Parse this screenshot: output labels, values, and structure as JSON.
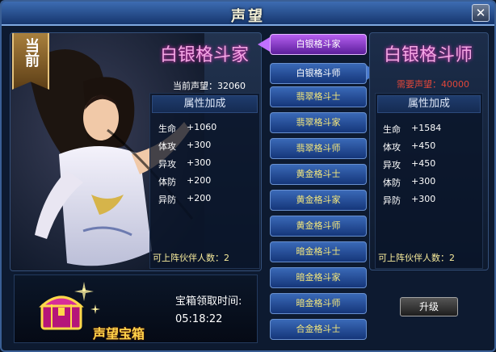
{
  "window": {
    "title": "声望",
    "close_label": "✕"
  },
  "current": {
    "badge": "当前",
    "rank_name": "白银格斗家",
    "reputation_label": "当前声望：32060",
    "stats_header": "属性加成",
    "stats": [
      {
        "name": "生命",
        "value": "+1060"
      },
      {
        "name": "体攻",
        "value": "+300"
      },
      {
        "name": "异攻",
        "value": "+300"
      },
      {
        "name": "体防",
        "value": "+200"
      },
      {
        "name": "异防",
        "value": "+200"
      }
    ],
    "partners_label": "可上阵伙伴人数：2"
  },
  "chest": {
    "name": "声望宝箱",
    "time_label": "宝箱领取时间:",
    "time_value": "05:18:22"
  },
  "ranks": [
    {
      "label": "白银格斗家",
      "state": "active"
    },
    {
      "label": "白银格斗师",
      "state": "selected"
    },
    {
      "label": "翡翠格斗士",
      "state": "normal"
    },
    {
      "label": "翡翠格斗家",
      "state": "normal"
    },
    {
      "label": "翡翠格斗师",
      "state": "normal"
    },
    {
      "label": "黄金格斗士",
      "state": "normal"
    },
    {
      "label": "黄金格斗家",
      "state": "normal"
    },
    {
      "label": "黄金格斗师",
      "state": "normal"
    },
    {
      "label": "暗金格斗士",
      "state": "normal"
    },
    {
      "label": "暗金格斗家",
      "state": "normal"
    },
    {
      "label": "暗金格斗师",
      "state": "normal"
    },
    {
      "label": "合金格斗士",
      "state": "normal"
    }
  ],
  "next": {
    "rank_name": "白银格斗师",
    "required_label": "需要声望：40000",
    "stats_header": "属性加成",
    "stats": [
      {
        "name": "生命",
        "value": "+1584"
      },
      {
        "name": "体攻",
        "value": "+450"
      },
      {
        "name": "异攻",
        "value": "+450"
      },
      {
        "name": "体防",
        "value": "+300"
      },
      {
        "name": "异防",
        "value": "+300"
      }
    ],
    "partners_label": "可上阵伙伴人数：2",
    "upgrade_label": "升级"
  },
  "colors": {
    "rank_name": "#f3a7e6",
    "required_reputation": "#e0463a",
    "button_text": "#f4e77c",
    "active_button": "#9b4fe0",
    "chest_label": "#ffd34a"
  },
  "icons": {
    "close": "close-icon",
    "chest": "treasure-chest-icon",
    "portrait": "character-portrait"
  }
}
